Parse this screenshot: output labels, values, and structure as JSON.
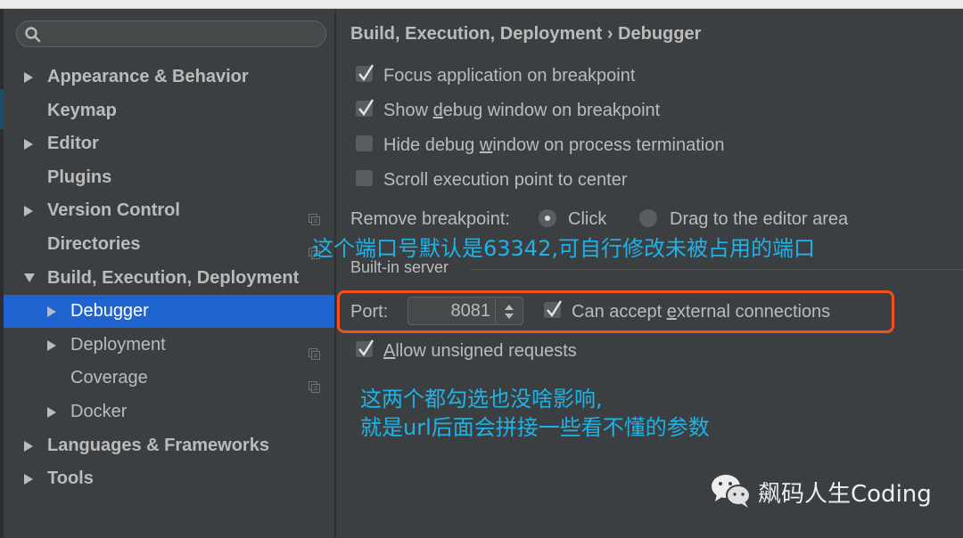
{
  "search": {
    "placeholder": "",
    "value": ""
  },
  "sidebar": {
    "items": [
      {
        "label": "Appearance & Behavior",
        "arrow": "collapsed",
        "bold": true,
        "level": 0,
        "project_icon": false
      },
      {
        "label": "Keymap",
        "arrow": "none",
        "bold": true,
        "level": 0,
        "project_icon": false
      },
      {
        "label": "Editor",
        "arrow": "collapsed",
        "bold": true,
        "level": 0,
        "project_icon": false
      },
      {
        "label": "Plugins",
        "arrow": "none",
        "bold": true,
        "level": 0,
        "project_icon": false
      },
      {
        "label": "Version Control",
        "arrow": "collapsed",
        "bold": true,
        "level": 0,
        "project_icon": true
      },
      {
        "label": "Directories",
        "arrow": "none",
        "bold": true,
        "level": 0,
        "project_icon": true
      },
      {
        "label": "Build, Execution, Deployment",
        "arrow": "expanded",
        "bold": true,
        "level": 0,
        "project_icon": false
      },
      {
        "label": "Debugger",
        "arrow": "collapsed",
        "bold": false,
        "level": 1,
        "project_icon": false,
        "selected": true
      },
      {
        "label": "Deployment",
        "arrow": "collapsed",
        "bold": false,
        "level": 1,
        "project_icon": true
      },
      {
        "label": "Coverage",
        "arrow": "none",
        "bold": false,
        "level": 1,
        "project_icon": true
      },
      {
        "label": "Docker",
        "arrow": "collapsed",
        "bold": false,
        "level": 1,
        "project_icon": false
      },
      {
        "label": "Languages & Frameworks",
        "arrow": "collapsed",
        "bold": true,
        "level": 0,
        "project_icon": false
      },
      {
        "label": "Tools",
        "arrow": "collapsed",
        "bold": true,
        "level": 0,
        "project_icon": false
      }
    ]
  },
  "content": {
    "breadcrumb": "Build, Execution, Deployment › Debugger",
    "options": [
      {
        "pre": "Focus application on breakpoint",
        "mn": "",
        "post": "",
        "checked": true
      },
      {
        "pre": "Show ",
        "mn": "d",
        "post": "ebug window on breakpoint",
        "checked": true
      },
      {
        "pre": "Hide debug ",
        "mn": "w",
        "post": "indow on process termination",
        "checked": false
      },
      {
        "pre": "Scroll execution point to center",
        "mn": "",
        "post": "",
        "checked": false
      }
    ],
    "remove_breakpoint": {
      "label": "Remove breakpoint:",
      "options": [
        {
          "label": "Click",
          "selected": true
        },
        {
          "label": "Drag to the editor area",
          "selected": false
        }
      ]
    },
    "builtin_server": {
      "title": "Built-in server",
      "port_label": "Port:",
      "port_value": "8081",
      "external": {
        "pre": "Can accept ",
        "mn": "e",
        "post": "xternal connections",
        "checked": true
      },
      "unsigned": {
        "pre": "",
        "mn": "A",
        "post": "llow unsigned requests",
        "checked": true
      }
    }
  },
  "annotations": {
    "port_note": "这个端口号默认是63342,可自行修改未被占用的端口",
    "check_note_line1": "这两个都勾选也没啥影响,",
    "check_note_line2": "就是url后面会拼接一些看不懂的参数",
    "color": "#1fb2e6",
    "highlight_color": "#f2501c"
  },
  "watermark": {
    "icon": "wechat-icon",
    "text": "飙码人生Coding"
  }
}
